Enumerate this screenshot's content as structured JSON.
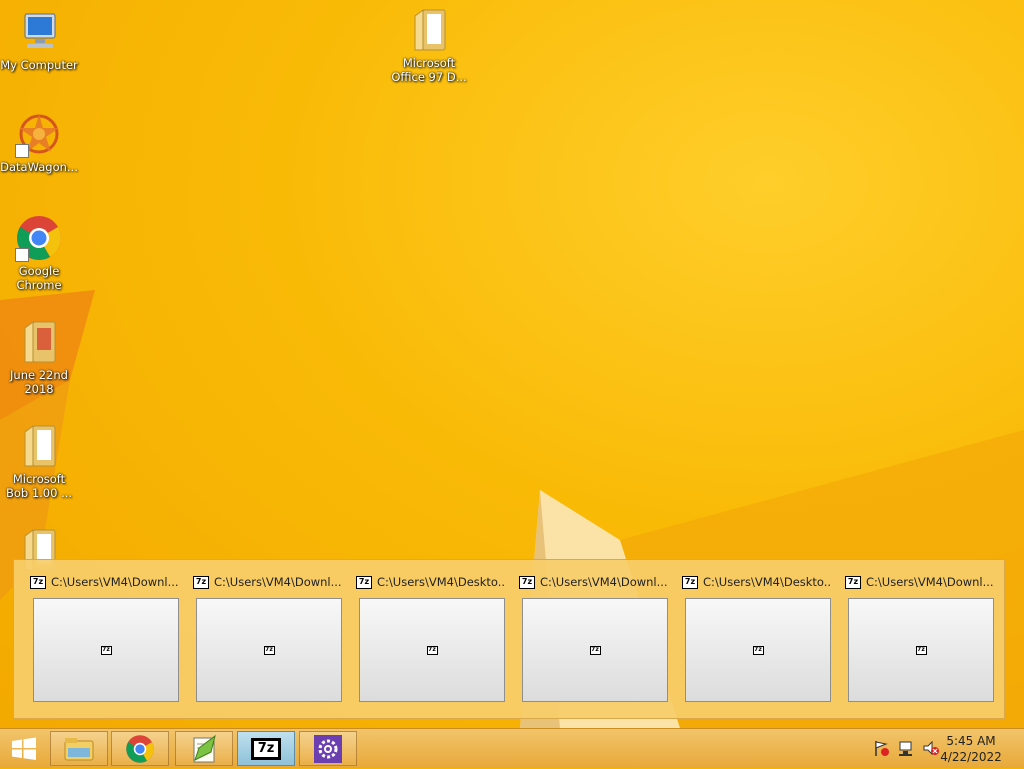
{
  "desktop": {
    "icons": [
      {
        "label": "My Computer",
        "icon": "computer-icon"
      },
      {
        "label": "DataWagon...",
        "icon": "datawagon-icon"
      },
      {
        "label": "Google Chrome",
        "icon": "chrome-icon"
      },
      {
        "label": "June 22nd 2018",
        "icon": "folder-icon"
      },
      {
        "label": "Microsoft Bob 1.00 ...",
        "icon": "folder-icon"
      },
      {
        "label": "Microsoft Office 97 D...",
        "icon": "folder-icon"
      }
    ]
  },
  "thumbnails": {
    "items": [
      {
        "title": "C:\\Users\\VM4\\Downl...",
        "icon": "7zip-icon"
      },
      {
        "title": "C:\\Users\\VM4\\Downl...",
        "icon": "7zip-icon"
      },
      {
        "title": "C:\\Users\\VM4\\Deskto...",
        "icon": "7zip-icon"
      },
      {
        "title": "C:\\Users\\VM4\\Downl...",
        "icon": "7zip-icon"
      },
      {
        "title": "C:\\Users\\VM4\\Deskto...",
        "icon": "7zip-icon"
      },
      {
        "title": "C:\\Users\\VM4\\Downl...",
        "icon": "7zip-icon"
      }
    ],
    "icon_text": "7z"
  },
  "taskbar": {
    "buttons": [
      {
        "icon": "file-explorer-icon"
      },
      {
        "icon": "chrome-icon"
      },
      {
        "icon": "notepad-plus-plus-icon"
      },
      {
        "icon": "7zip-icon",
        "active": true
      },
      {
        "icon": "settings-icon"
      }
    ],
    "seven_zip_text": "7z",
    "tray": [
      "action-center-flag-icon",
      "network-icon",
      "volume-muted-icon"
    ],
    "clock": {
      "time": "5:45 AM",
      "date": "4/22/2022"
    }
  },
  "colors": {
    "accent": "#f7b400",
    "active_button": "#8fc1d8"
  }
}
